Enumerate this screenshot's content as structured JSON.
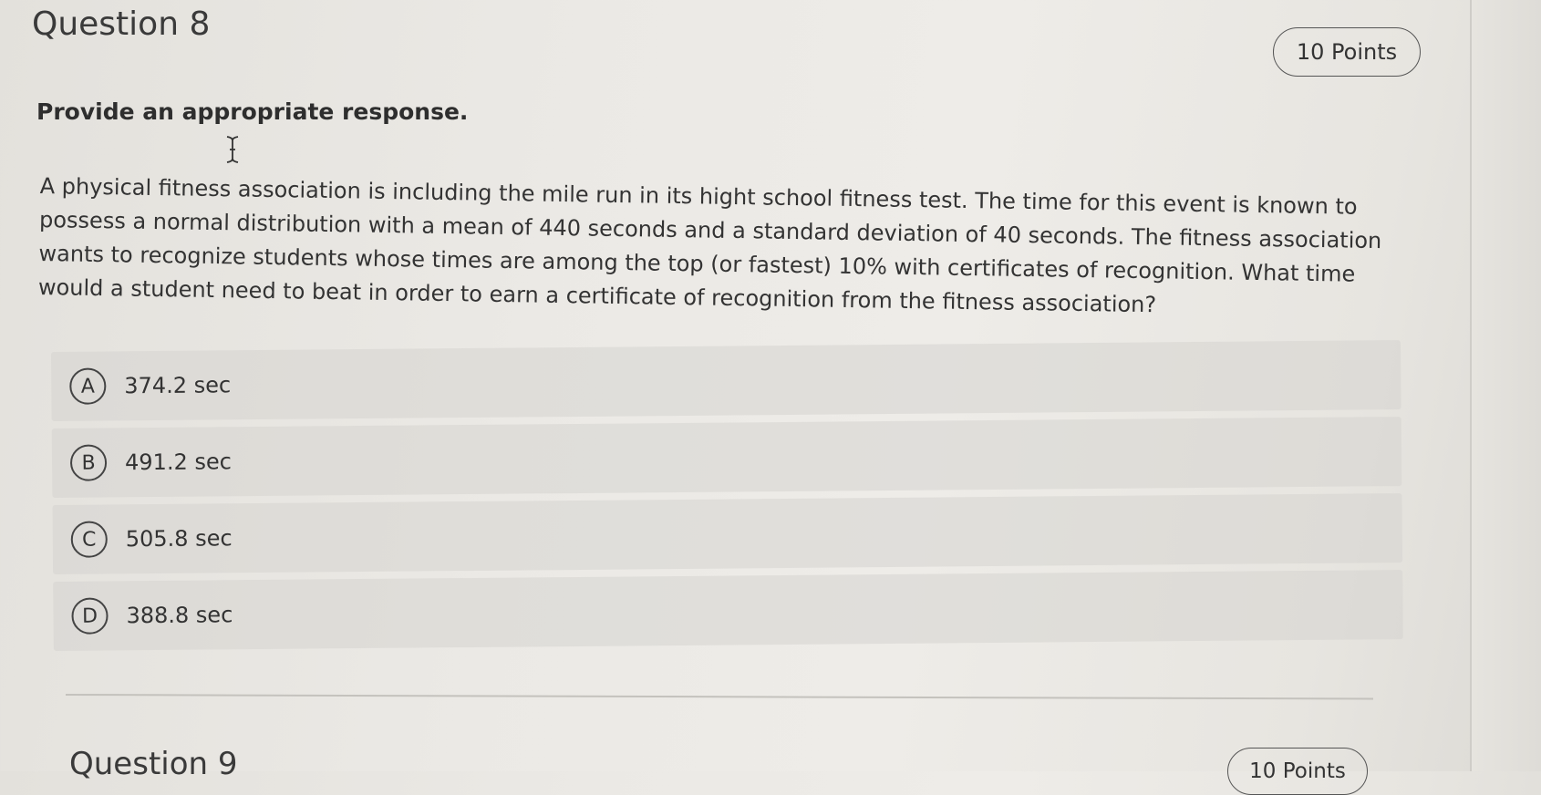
{
  "question": {
    "title": "Question 8",
    "points": "10 Points",
    "instruction": "Provide an appropriate response.",
    "text": "A physical fitness association is including the mile run in its hight school fitness test. The time for this event is known to possess a normal distribution with a mean of 440 seconds and a standard deviation of 40 seconds. The fitness association wants to recognize students whose times are among the top (or fastest) 10% with certificates of recognition. What time would a student need to beat in order to earn a certificate of recognition from the fitness association?",
    "options": [
      {
        "letter": "A",
        "text": "374.2 sec"
      },
      {
        "letter": "B",
        "text": "491.2 sec"
      },
      {
        "letter": "C",
        "text": "505.8 sec"
      },
      {
        "letter": "D",
        "text": "388.8 sec"
      }
    ]
  },
  "next_question": {
    "title": "Question 9",
    "points": "10 Points"
  },
  "icons": {
    "cursor": "text-cursor-icon"
  },
  "colors": {
    "background": "#ebe9e5",
    "option_background": "#dcdad5",
    "text": "#333333"
  }
}
